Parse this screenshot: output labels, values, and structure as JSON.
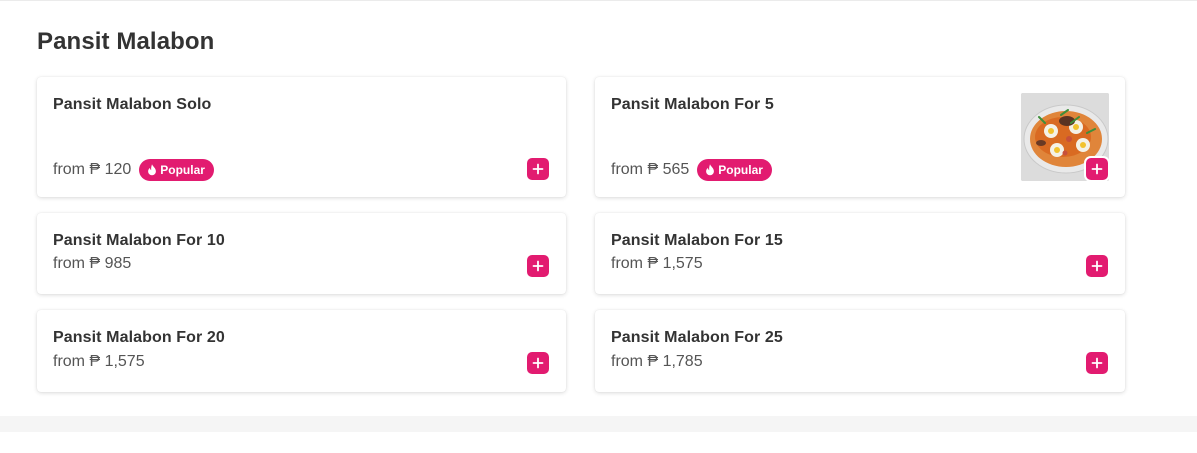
{
  "section": {
    "title": "Pansit Malabon"
  },
  "items": [
    {
      "name": "Pansit Malabon Solo",
      "price": "from ₱ 120",
      "popular": true,
      "has_image": false
    },
    {
      "name": "Pansit Malabon For 5",
      "price": "from ₱ 565",
      "popular": true,
      "has_image": true
    },
    {
      "name": "Pansit Malabon For 10",
      "price": "from ₱ 985",
      "popular": false,
      "has_image": false
    },
    {
      "name": "Pansit Malabon For 15",
      "price": "from ₱ 1,575",
      "popular": false,
      "has_image": false
    },
    {
      "name": "Pansit Malabon For 20",
      "price": "from ₱ 1,575",
      "popular": false,
      "has_image": false
    },
    {
      "name": "Pansit Malabon For 25",
      "price": "from ₱ 1,785",
      "popular": false,
      "has_image": false
    }
  ],
  "badge": {
    "label": "Popular",
    "icon": "flame-icon"
  },
  "add_icon": "plus-icon",
  "colors": {
    "accent": "#e21b70",
    "text": "#333333",
    "muted": "#555555"
  }
}
